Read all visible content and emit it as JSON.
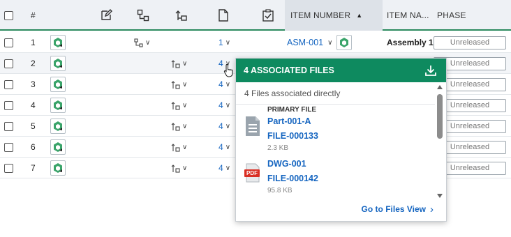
{
  "header": {
    "index_label": "#",
    "item_number_label": "ITEM NUMBER",
    "item_name_label": "ITEM NA...",
    "phase_label": "PHASE",
    "sort_indicator": "▲"
  },
  "rows": [
    {
      "index": "1",
      "files": "1",
      "item_number": "ASM-001",
      "item_name": "Assembly 1",
      "phase": "Unreleased"
    },
    {
      "index": "2",
      "files": "4",
      "phase": "Unreleased"
    },
    {
      "index": "3",
      "files": "4",
      "phase": "Unreleased"
    },
    {
      "index": "4",
      "files": "4",
      "phase": "Unreleased"
    },
    {
      "index": "5",
      "files": "4",
      "phase": "Unreleased"
    },
    {
      "index": "6",
      "files": "4",
      "phase": "Unreleased"
    },
    {
      "index": "7",
      "files": "4",
      "phase": "Unreleased"
    }
  ],
  "popup": {
    "title": "4 ASSOCIATED FILES",
    "subtitle": "4 Files associated directly",
    "primary_label": "PRIMARY FILE",
    "files": [
      {
        "name": "Part-001-A",
        "id": "FILE-000133",
        "size": "2.3 KB",
        "type_badge": ""
      },
      {
        "name": "DWG-001",
        "id": "FILE-000142",
        "size": "95.8 KB",
        "type_badge": "PDF"
      }
    ],
    "footer_link": "Go to Files View",
    "footer_chevron": "›"
  },
  "colors": {
    "accent_green": "#0e8a5f",
    "link_blue": "#1565c0",
    "pdf_red": "#d93025"
  }
}
